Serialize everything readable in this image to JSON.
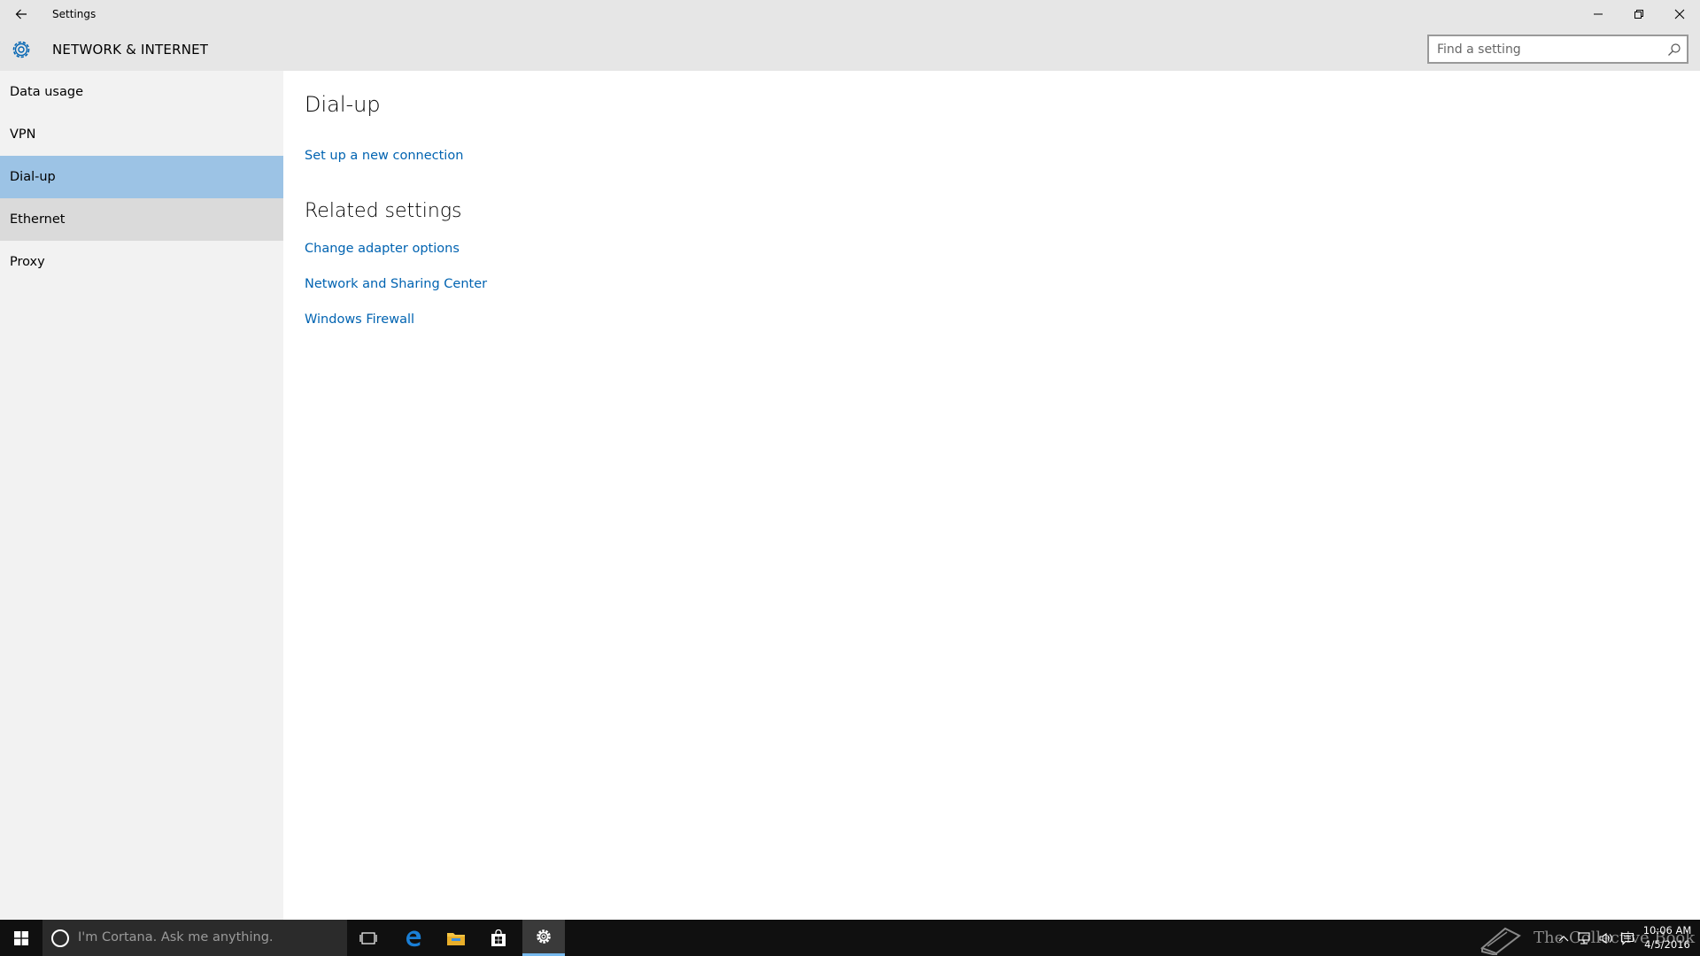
{
  "window": {
    "title": "Settings"
  },
  "header": {
    "section_title": "NETWORK & INTERNET",
    "search_placeholder": "Find a setting"
  },
  "sidebar": {
    "items": [
      {
        "label": "Data usage",
        "state": "normal"
      },
      {
        "label": "VPN",
        "state": "normal"
      },
      {
        "label": "Dial-up",
        "state": "selected"
      },
      {
        "label": "Ethernet",
        "state": "hover"
      },
      {
        "label": "Proxy",
        "state": "normal"
      }
    ]
  },
  "main": {
    "page_title": "Dial-up",
    "setup_link": "Set up a new connection",
    "related_heading": "Related settings",
    "related_links": [
      "Change adapter options",
      "Network and Sharing Center",
      "Windows Firewall"
    ]
  },
  "taskbar": {
    "cortana_placeholder": "I'm Cortana. Ask me anything.",
    "watermark_text": "The Collective Book",
    "clock_time": "10:06 AM",
    "clock_date": "4/5/2016"
  },
  "colors": {
    "accent": "#0063b1",
    "selected_nav": "#9cc3e5",
    "chrome": "#e6e6e6",
    "sidebar": "#f2f2f2",
    "taskbar": "#101010"
  }
}
